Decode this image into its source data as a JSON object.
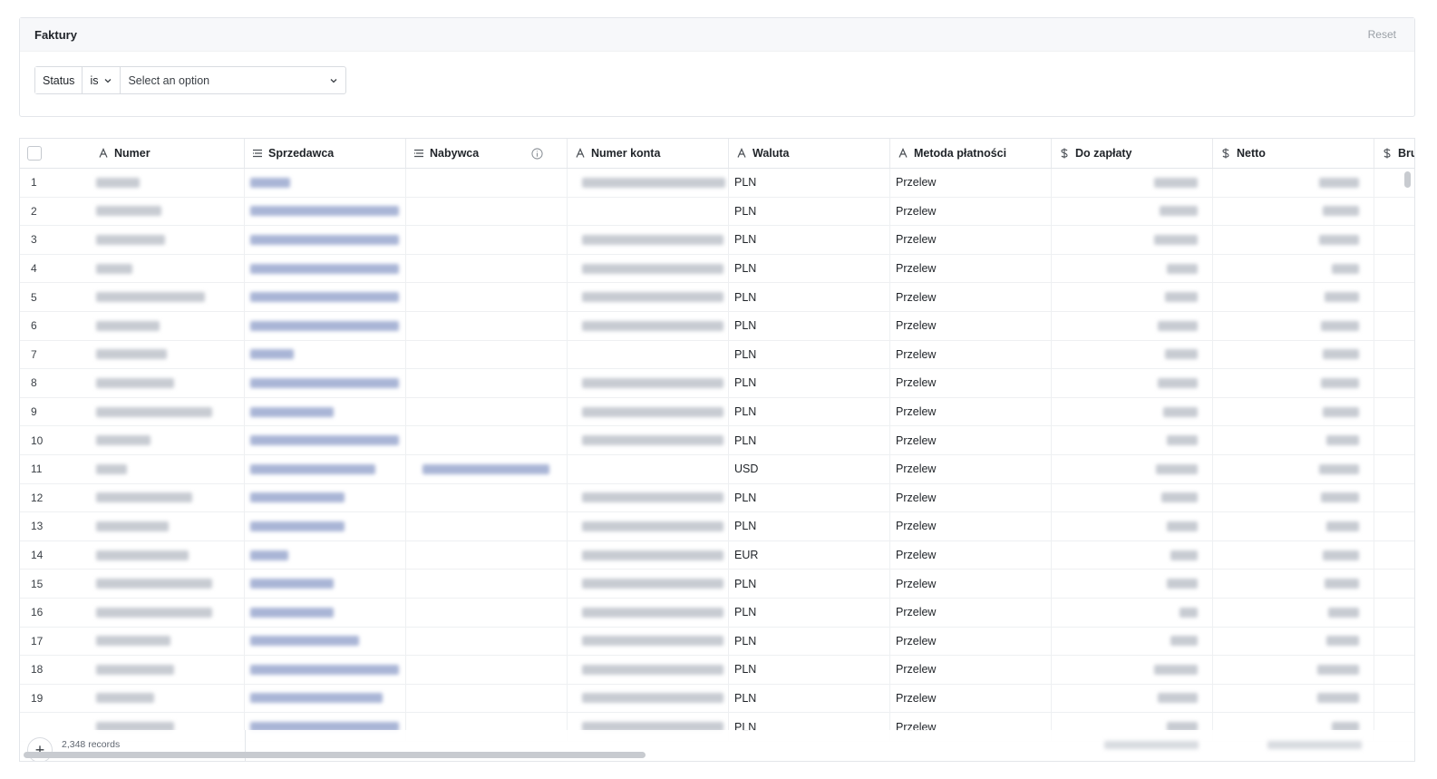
{
  "filter": {
    "title": "Faktury",
    "reset_label": "Reset",
    "field": "Status",
    "operator": "is",
    "select_placeholder": "Select an option"
  },
  "columns": [
    {
      "label": "Numer",
      "icon": "text-type-icon"
    },
    {
      "label": "Sprzedawca",
      "icon": "lookup-list-icon"
    },
    {
      "label": "Nabywca",
      "icon": "lookup-list-icon"
    },
    {
      "label": "Numer konta",
      "icon": "text-type-icon"
    },
    {
      "label": "Waluta",
      "icon": "text-type-icon"
    },
    {
      "label": "Metoda płatności",
      "icon": "text-type-icon"
    },
    {
      "label": "Do zapłaty",
      "icon": "currency-icon"
    },
    {
      "label": "Netto",
      "icon": "currency-icon"
    },
    {
      "label": "Bru",
      "icon": "currency-icon"
    }
  ],
  "rows": [
    {
      "n": "1",
      "waluta": "PLN",
      "metoda": "Przelew"
    },
    {
      "n": "2",
      "waluta": "PLN",
      "metoda": "Przelew"
    },
    {
      "n": "3",
      "waluta": "PLN",
      "metoda": "Przelew"
    },
    {
      "n": "4",
      "waluta": "PLN",
      "metoda": "Przelew"
    },
    {
      "n": "5",
      "waluta": "PLN",
      "metoda": "Przelew"
    },
    {
      "n": "6",
      "waluta": "PLN",
      "metoda": "Przelew"
    },
    {
      "n": "7",
      "waluta": "PLN",
      "metoda": "Przelew"
    },
    {
      "n": "8",
      "waluta": "PLN",
      "metoda": "Przelew"
    },
    {
      "n": "9",
      "waluta": "PLN",
      "metoda": "Przelew"
    },
    {
      "n": "10",
      "waluta": "PLN",
      "metoda": "Przelew"
    },
    {
      "n": "11",
      "waluta": "USD",
      "metoda": "Przelew"
    },
    {
      "n": "12",
      "waluta": "PLN",
      "metoda": "Przelew"
    },
    {
      "n": "13",
      "waluta": "PLN",
      "metoda": "Przelew"
    },
    {
      "n": "14",
      "waluta": "EUR",
      "metoda": "Przelew"
    },
    {
      "n": "15",
      "waluta": "PLN",
      "metoda": "Przelew"
    },
    {
      "n": "16",
      "waluta": "PLN",
      "metoda": "Przelew"
    },
    {
      "n": "17",
      "waluta": "PLN",
      "metoda": "Przelew"
    },
    {
      "n": "18",
      "waluta": "PLN",
      "metoda": "Przelew"
    },
    {
      "n": "19",
      "waluta": "PLN",
      "metoda": "Przelew"
    },
    {
      "n": "",
      "waluta": "PLN",
      "metoda": "Przelew"
    }
  ],
  "footer": {
    "record_count": "2,348 records",
    "add_label": "+"
  }
}
